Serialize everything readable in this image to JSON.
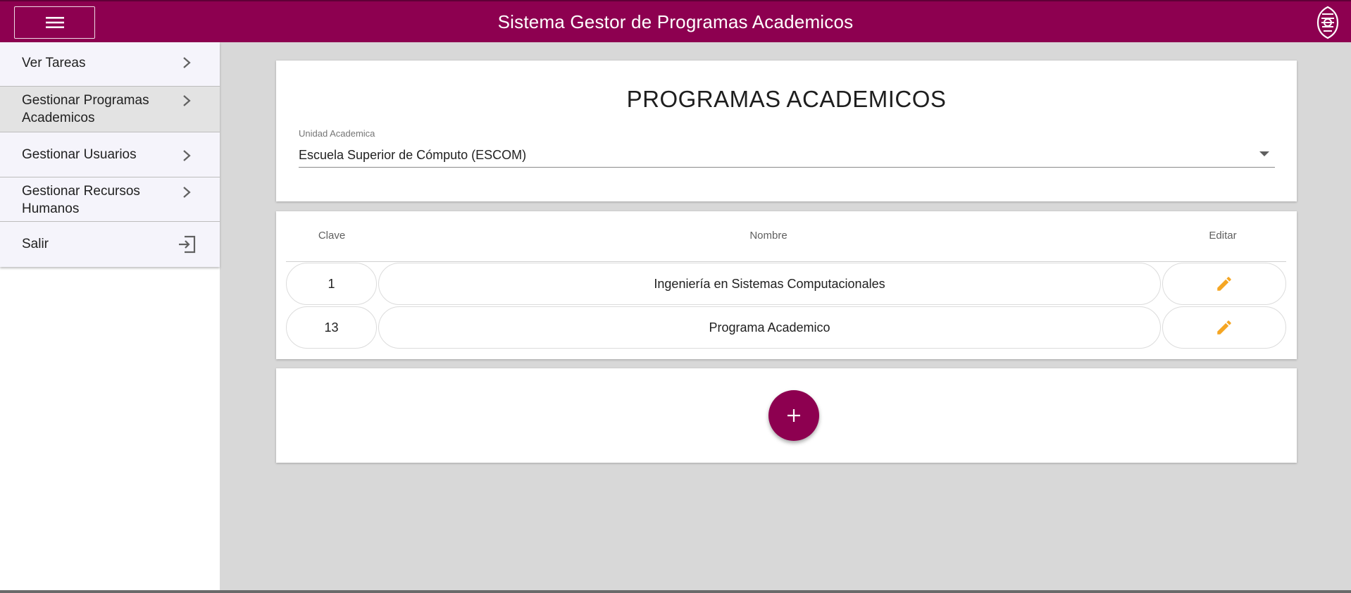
{
  "header": {
    "title": "Sistema Gestor de Programas Academicos",
    "menu_icon": "hamburger-menu-icon",
    "logo": "institution-logo"
  },
  "sidebar": {
    "items": [
      {
        "label": "Ver Tareas",
        "icon": "chevron-right-icon"
      },
      {
        "label": "Gestionar Programas Academicos",
        "icon": "chevron-right-icon",
        "active": true
      },
      {
        "label": "Gestionar Usuarios",
        "icon": "chevron-right-icon"
      },
      {
        "label": "Gestionar Recursos Humanos",
        "icon": "chevron-right-icon"
      },
      {
        "label": "Salir",
        "icon": "exit-icon"
      }
    ]
  },
  "main": {
    "title": "PROGRAMAS ACADEMICOS",
    "unidad": {
      "label": "Unidad Academica",
      "value": "Escuela Superior de Cómputo (ESCOM)"
    },
    "table": {
      "columns": [
        "Clave",
        "Nombre",
        "Editar"
      ],
      "rows": [
        {
          "clave": "1",
          "nombre": "Ingeniería en Sistemas Computacionales"
        },
        {
          "clave": "13",
          "nombre": "Programa Academico"
        }
      ]
    },
    "add_button": {
      "icon": "plus-icon"
    }
  },
  "colors": {
    "primary": "#8d0050",
    "edit_icon": "#f5a623",
    "background": "#d8d8d8"
  }
}
